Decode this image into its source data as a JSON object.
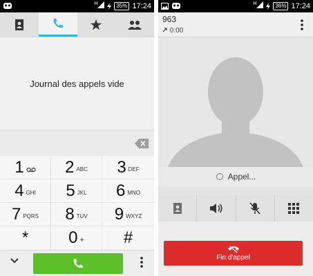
{
  "left": {
    "status": {
      "battery": "35%",
      "time": "17:24",
      "signal_label": "H"
    },
    "tabs": [
      {
        "icon": "contacts-icon"
      },
      {
        "icon": "phone-icon",
        "active": true
      },
      {
        "icon": "star-icon"
      },
      {
        "icon": "group-icon"
      }
    ],
    "empty_log": "Journal des appels vide",
    "keys": [
      {
        "num": "1",
        "sub": ""
      },
      {
        "num": "2",
        "sub": "ABC"
      },
      {
        "num": "3",
        "sub": "DEF"
      },
      {
        "num": "4",
        "sub": "GHI"
      },
      {
        "num": "5",
        "sub": "JKL"
      },
      {
        "num": "6",
        "sub": "MNO"
      },
      {
        "num": "7",
        "sub": "PQRS"
      },
      {
        "num": "8",
        "sub": "TUV"
      },
      {
        "num": "9",
        "sub": "WXYZ"
      },
      {
        "num": "*",
        "sub": ""
      },
      {
        "num": "0",
        "sub": "+"
      },
      {
        "num": "#",
        "sub": ""
      }
    ]
  },
  "right": {
    "status": {
      "battery": "36%",
      "time": "17:24",
      "signal_label": "H"
    },
    "number": "963",
    "duration": "0:00",
    "call_status": "Appel...",
    "end_call_label": "Fin d'appel",
    "actions": [
      "contacts-icon",
      "speaker-icon",
      "mute-mic-icon",
      "dialpad-icon"
    ]
  },
  "colors": {
    "accent": "#33b5e5",
    "call_green": "#5cbf2a",
    "end_red": "#dd2c2c"
  }
}
